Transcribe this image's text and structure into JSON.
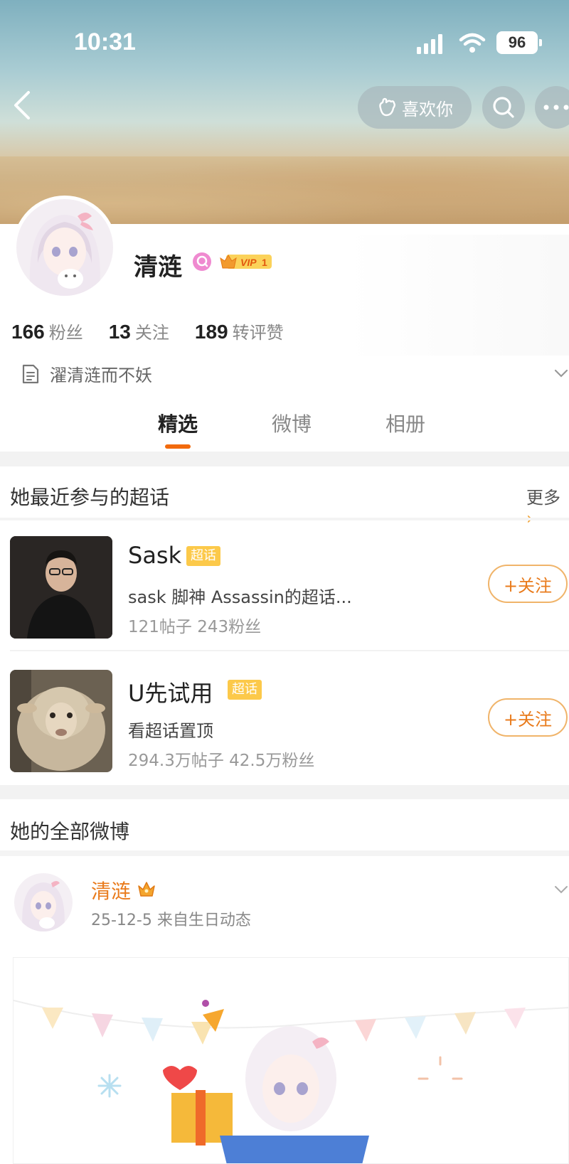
{
  "status_bar": {
    "time": "10:31",
    "battery": "96"
  },
  "header": {
    "like_label": "喜欢你"
  },
  "profile": {
    "name": "清涟",
    "stats": [
      {
        "value": "166",
        "label": "粉丝"
      },
      {
        "value": "13",
        "label": "关注"
      },
      {
        "value": "189",
        "label": "转评赞"
      }
    ],
    "bio": "濯清涟而不妖"
  },
  "tabs": [
    {
      "label": "精选",
      "active": true
    },
    {
      "label": "微博",
      "active": false
    },
    {
      "label": "相册",
      "active": false
    }
  ],
  "super_topics": {
    "heading": "她最近参与的超话",
    "more_label": "更多",
    "badge_label": "超话",
    "follow_label": "+关注",
    "items": [
      {
        "title": "Sask",
        "desc": "sask 脚神 Assassin的超话...",
        "meta": "121帖子 243粉丝"
      },
      {
        "title": "U先试用",
        "desc": "看超话置顶",
        "meta": "294.3万帖子 42.5万粉丝"
      }
    ]
  },
  "weibo": {
    "heading": "她的全部微博",
    "post": {
      "author": "清涟",
      "meta": "25-12-5  来自生日动态"
    }
  },
  "colors": {
    "accent": "#f26a0d",
    "follow_border": "#f0b46a",
    "badge": "#fcc94a"
  },
  "icons": [
    "back-icon",
    "like-hand-icon",
    "search-icon",
    "more-icon",
    "verify-icon",
    "vip-badge-icon",
    "document-icon",
    "chevron-down-icon",
    "crown-icon"
  ]
}
